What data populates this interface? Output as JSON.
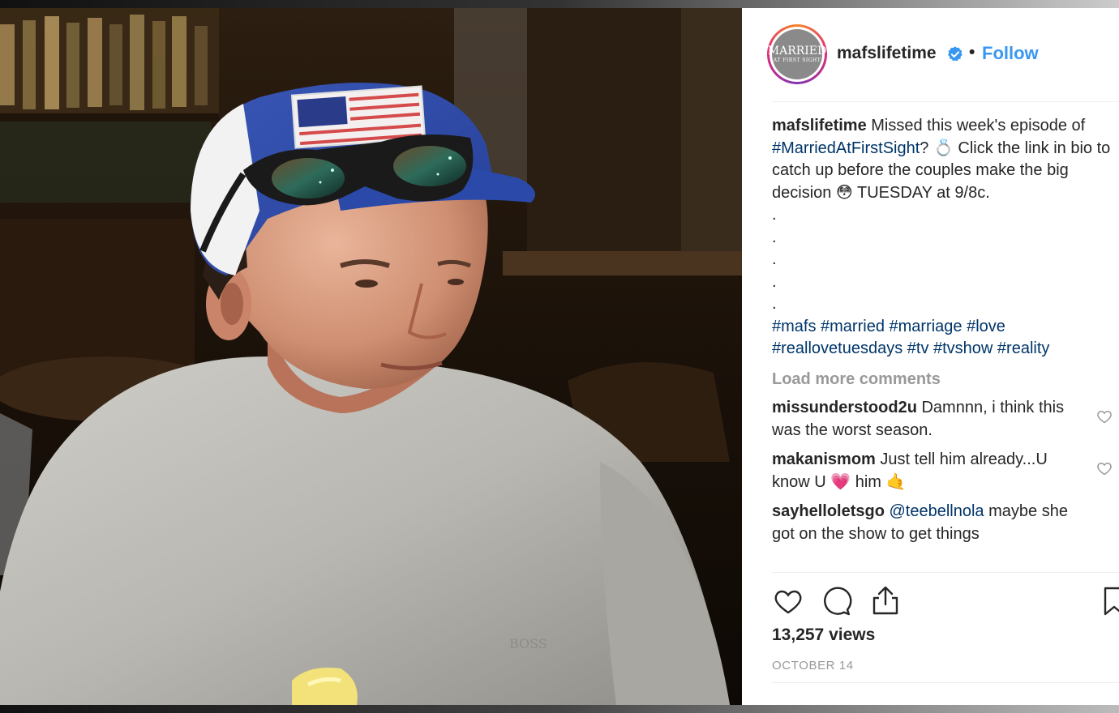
{
  "post": {
    "username": "mafslifetime",
    "separator": "•",
    "follow_label": "Follow",
    "avatar_text_line1": "MARRIED",
    "avatar_text_line2": "AT FIRST SIGHT",
    "caption_user": "mafslifetime",
    "caption_text_1": " Missed this week's episode of ",
    "caption_hashtag": "#MarriedAtFirstSight",
    "caption_text_2": "? 💍 Click the link in bio to catch up before the couples make the big decision 😳 TUESDAY at 9/8c.",
    "caption_dots": [
      ".",
      ".",
      ".",
      ".",
      "."
    ],
    "hashtags_line1": "#mafs #married #marriage #love",
    "hashtags_line2": "#reallovetuesdays #tv #tvshow #reality",
    "load_more": "Load more comments",
    "comments": [
      {
        "user": "missunderstood2u",
        "text": " Damnnn, i think this was the worst season."
      },
      {
        "user": "makanismom",
        "text": " Just tell him already...U know U 💗 him 🤙"
      },
      {
        "user": "sayhelloletsgo",
        "mention": "@teebellnola",
        "text": " maybe she got on the show to get things"
      }
    ],
    "views": "13,257 views",
    "date": "OCTOBER 14"
  },
  "media": {
    "shirt_text": "BOSS"
  },
  "colors": {
    "link_blue": "#3897f0",
    "hashtag_blue": "#003569",
    "muted": "#999999",
    "text": "#262626"
  },
  "icons": [
    "verified-badge-icon",
    "heart-icon",
    "comment-icon",
    "share-icon",
    "bookmark-icon"
  ]
}
